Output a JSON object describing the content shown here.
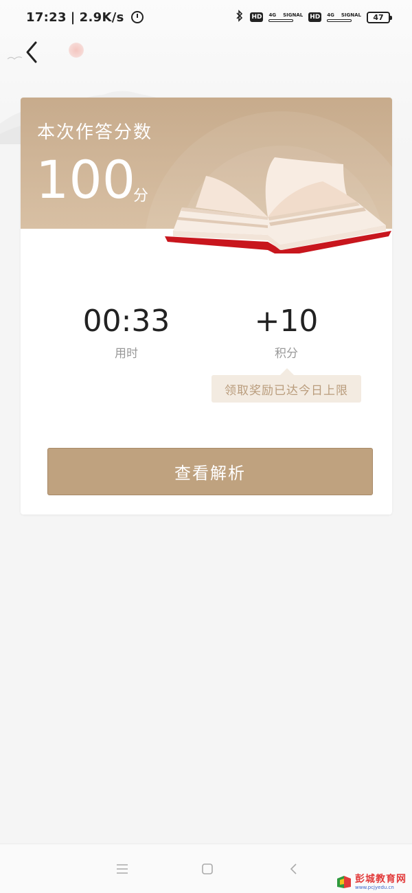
{
  "status_bar": {
    "time": "17:23",
    "separator": "|",
    "network_speed": "2.9K/s",
    "alarm_icon": "alarm-icon",
    "bluetooth_icon": "bluetooth-icon",
    "hd1": "HD",
    "sim1_type": "4G",
    "sim1_label": "SIGNAL",
    "hd2": "HD",
    "sim2_type": "4G",
    "sim2_label": "SIGNAL",
    "battery": "47"
  },
  "header": {
    "back_icon": "back-arrow-icon"
  },
  "result_card": {
    "score_label": "本次作答分数",
    "score_value": "100",
    "score_unit": "分",
    "time_value": "00:33",
    "time_label": "用时",
    "points_value": "+10",
    "points_label": "积分",
    "limit_tip": "领取奖励已达今日上限",
    "analysis_button": "查看解析"
  },
  "nav_bar": {
    "menu_icon": "menu-icon",
    "home_icon": "home-square-icon",
    "back_icon": "nav-back-icon"
  },
  "watermark": {
    "title": "彭城教育网",
    "url": "www.pcjyedu.cn"
  },
  "colors": {
    "accent": "#bfa27f",
    "header_bg": "#c7ab8c",
    "tip_bg": "#f3ebe1",
    "tip_text": "#b99c7c",
    "book_red": "#c8161d"
  }
}
